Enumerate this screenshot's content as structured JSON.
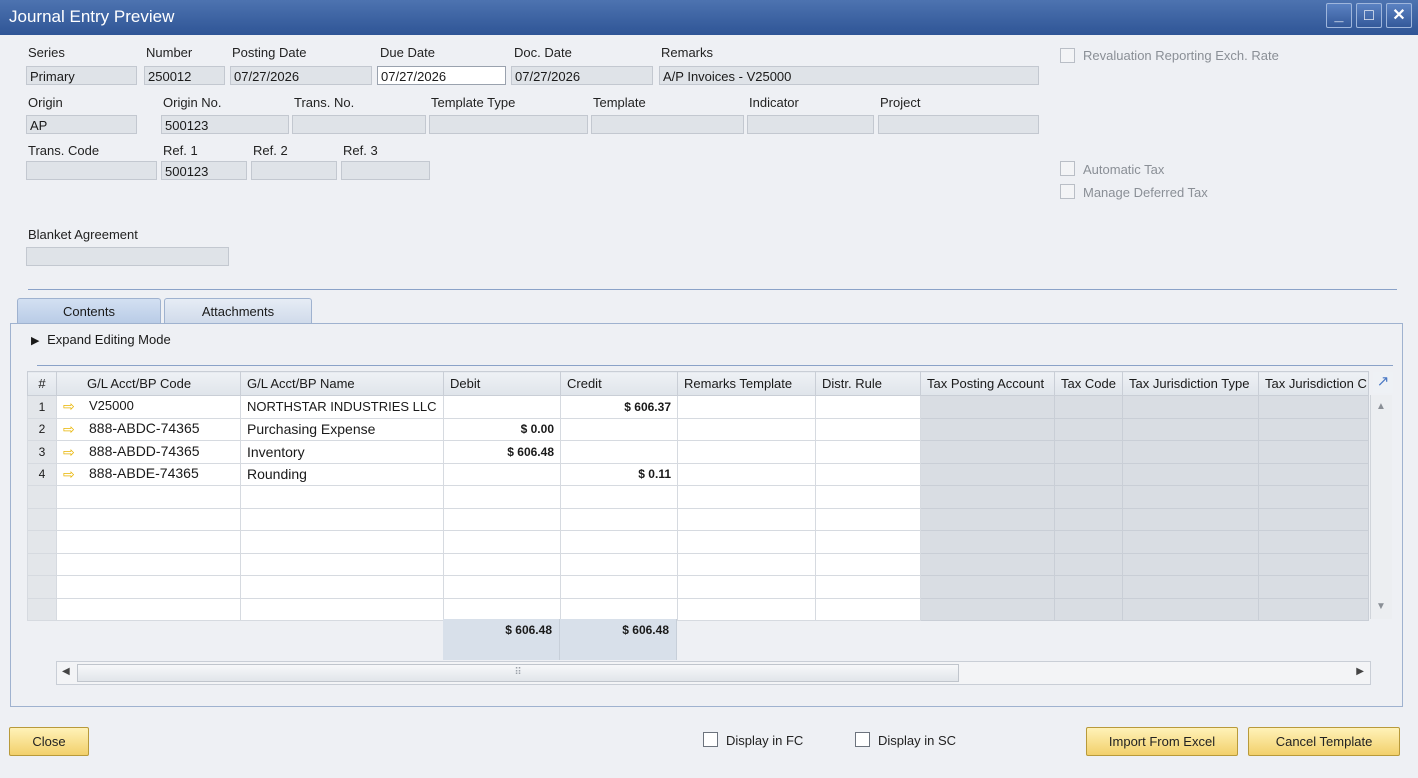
{
  "window": {
    "title": "Journal Entry Preview",
    "minimize": "_",
    "maximize": "□",
    "close": "✕"
  },
  "header": {
    "series": {
      "label": "Series",
      "value": "Primary"
    },
    "number": {
      "label": "Number",
      "value": "250012"
    },
    "posting_date": {
      "label": "Posting Date",
      "value": "07/27/2026"
    },
    "due_date": {
      "label": "Due Date",
      "value": "07/27/2026"
    },
    "doc_date": {
      "label": "Doc. Date",
      "value": "07/27/2026"
    },
    "remarks": {
      "label": "Remarks",
      "value": "A/P Invoices - V25000"
    },
    "origin": {
      "label": "Origin",
      "value": "AP"
    },
    "origin_no": {
      "label": "Origin No.",
      "value": "500123"
    },
    "trans_no": {
      "label": "Trans. No.",
      "value": ""
    },
    "template_type": {
      "label": "Template Type",
      "value": ""
    },
    "template": {
      "label": "Template",
      "value": ""
    },
    "indicator": {
      "label": "Indicator",
      "value": ""
    },
    "project": {
      "label": "Project",
      "value": ""
    },
    "trans_code": {
      "label": "Trans. Code",
      "value": ""
    },
    "ref1": {
      "label": "Ref. 1",
      "value": "500123"
    },
    "ref2": {
      "label": "Ref. 2",
      "value": ""
    },
    "ref3": {
      "label": "Ref. 3",
      "value": ""
    },
    "blanket_agreement": {
      "label": "Blanket Agreement",
      "value": ""
    }
  },
  "options": {
    "revaluation": "Revaluation Reporting Exch. Rate",
    "automatic_tax": "Automatic Tax",
    "manage_deferred_tax": "Manage Deferred Tax"
  },
  "tabs": [
    {
      "label": "Contents"
    },
    {
      "label": "Attachments"
    }
  ],
  "expand_editing_mode": "Expand Editing Mode",
  "grid": {
    "columns": [
      "#",
      "G/L Acct/BP Code",
      "G/L Acct/BP Name",
      "Debit",
      "Credit",
      "Remarks Template",
      "Distr. Rule",
      "Tax Posting Account",
      "Tax Code",
      "Tax Jurisdiction Type",
      "Tax Jurisdiction C"
    ],
    "rows": [
      {
        "num": "1",
        "code": "V25000",
        "name": "NORTHSTAR INDUSTRIES LLC",
        "debit": "",
        "credit": "$ 606.37"
      },
      {
        "num": "2",
        "code": "888-ABDC-74365",
        "name": "Purchasing Expense",
        "debit": "$ 0.00",
        "credit": ""
      },
      {
        "num": "3",
        "code": "888-ABDD-74365",
        "name": "Inventory",
        "debit": "$ 606.48",
        "credit": ""
      },
      {
        "num": "4",
        "code": "888-ABDE-74365",
        "name": "Rounding",
        "debit": "",
        "credit": "$ 0.11"
      }
    ],
    "totals": {
      "debit": "$ 606.48",
      "credit": "$ 606.48"
    }
  },
  "footer": {
    "close": "Close",
    "display_fc": "Display in FC",
    "display_sc": "Display in SC",
    "import_excel": "Import From Excel",
    "cancel_template": "Cancel Template"
  }
}
